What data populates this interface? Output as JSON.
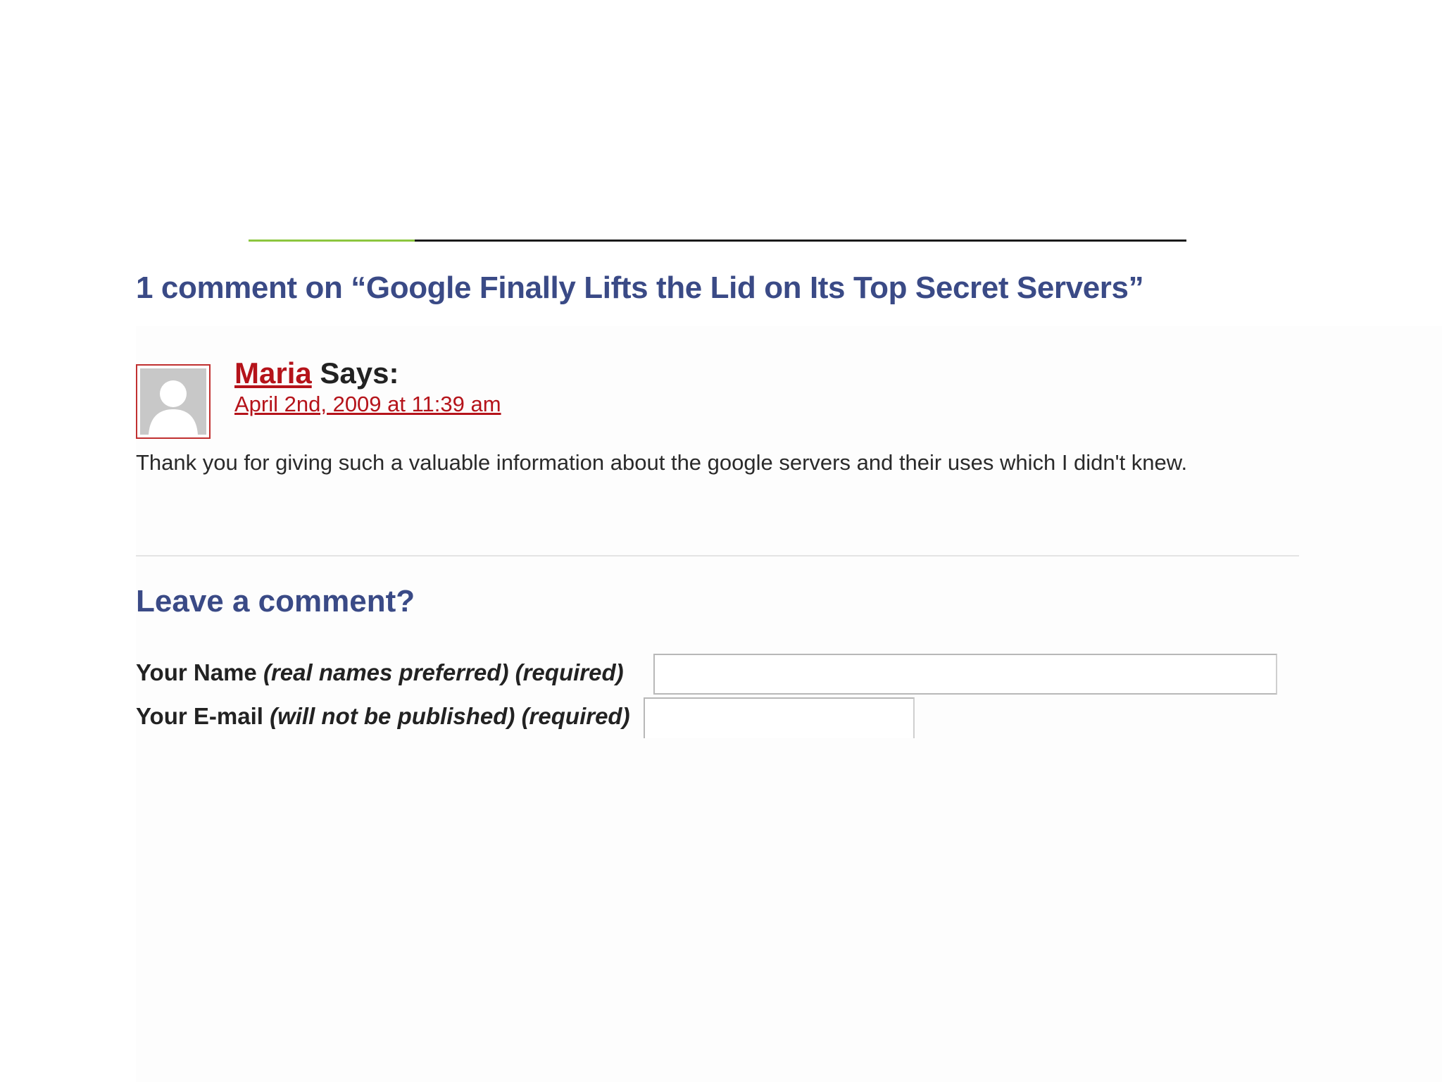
{
  "comments": {
    "title": "1 comment on “Google Finally Lifts the Lid on Its Top Secret Servers”",
    "items": [
      {
        "author": "Maria",
        "says": " Says:",
        "date": "April 2nd, 2009 at 11:39 am",
        "body": "Thank you for giving such a valuable information about the google servers and their uses which I didn't knew."
      }
    ]
  },
  "form": {
    "title": "Leave a comment?",
    "name_label": "Your Name",
    "name_note": "(real names preferred) (required)",
    "name_value": "",
    "email_label": "Your E-mail",
    "email_note": "(will not be published) (required)",
    "email_value": ""
  },
  "colors": {
    "heading": "#3a4a86",
    "link": "#b5131a",
    "accent": "#8cc63f"
  }
}
